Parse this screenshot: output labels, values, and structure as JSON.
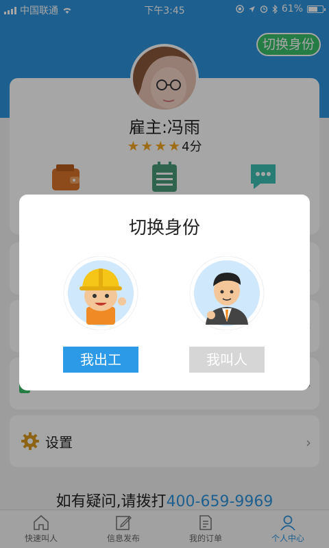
{
  "status": {
    "carrier": "中国联通",
    "time": "下午3:45",
    "battery": "61%"
  },
  "header": {
    "switch_label": "切换身份"
  },
  "profile": {
    "name": "雇主:冯雨",
    "rating_text": "4分",
    "stars": 4
  },
  "quick_actions": [
    {
      "icon": "wallet-icon",
      "color": "#d9742b"
    },
    {
      "icon": "notebook-icon",
      "color": "#4a9a78"
    },
    {
      "icon": "message-icon",
      "color": "#3cbfb1"
    }
  ],
  "settings": {
    "label": "设置"
  },
  "help": {
    "prefix": "如有疑问,请拨打",
    "phone": "400-659-9969"
  },
  "tabs": [
    {
      "label": "快速叫人",
      "icon": "home-icon"
    },
    {
      "label": "信息发布",
      "icon": "edit-icon"
    },
    {
      "label": "我的订单",
      "icon": "orders-icon"
    },
    {
      "label": "个人中心",
      "icon": "person-icon"
    }
  ],
  "dialog": {
    "title": "切换身份",
    "worker_label": "我出工",
    "employer_label": "我叫人"
  },
  "colors": {
    "brand_blue": "#2d93dc",
    "switch_green": "#3ac06b"
  }
}
